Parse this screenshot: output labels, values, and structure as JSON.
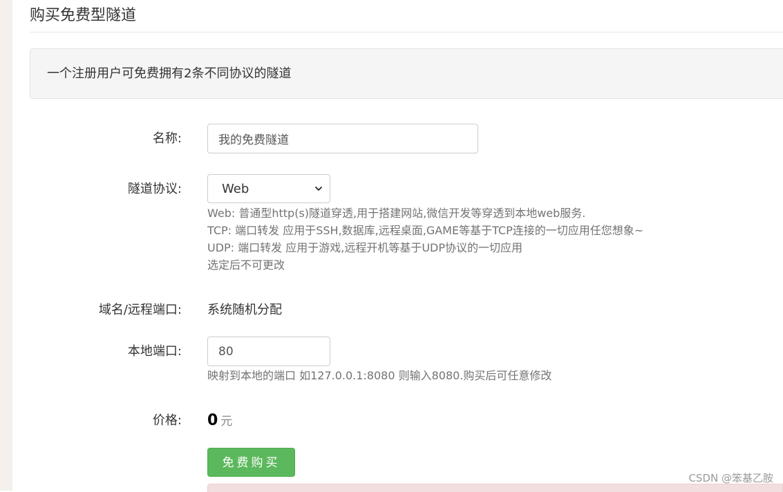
{
  "page": {
    "title": "购买免费型隧道"
  },
  "notice": {
    "text": "一个注册用户可免费拥有2条不同协议的隧道"
  },
  "form": {
    "name": {
      "label": "名称:",
      "value": "我的免费隧道"
    },
    "protocol": {
      "label": "隧道协议:",
      "selected": "Web",
      "help": [
        "Web: 普通型http(s)隧道穿透,用于搭建网站,微信开发等穿透到本地web服务.",
        "TCP: 端口转发 应用于SSH,数据库,远程桌面,GAME等基于TCP连接的一切应用任您想象~",
        "UDP: 端口转发 应用于游戏,远程开机等基于UDP协议的一切应用",
        "选定后不可更改"
      ]
    },
    "remote": {
      "label": "域名/远程端口:",
      "value": "系统随机分配"
    },
    "local_port": {
      "label": "本地端口:",
      "value": "80",
      "help": "映射到本地的端口 如127.0.0.1:8080 则输入8080.购买后可任意修改"
    },
    "price": {
      "label": "价格:",
      "amount": "0",
      "unit": "元"
    },
    "submit_label": "免费购买"
  },
  "watermark": "CSDN @笨基乙胺",
  "colors": {
    "button_bg": "#5cb85c",
    "alert_bg": "#f2dede",
    "notice_bg": "#f5f5f5"
  }
}
